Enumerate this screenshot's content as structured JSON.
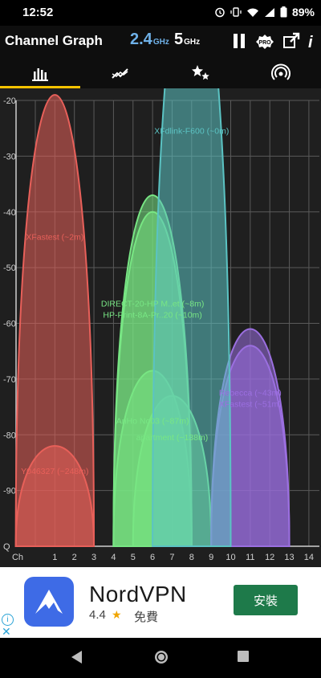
{
  "status": {
    "time": "12:52",
    "battery": "89%"
  },
  "app": {
    "title": "Channel Graph",
    "band24": {
      "num": "2.4",
      "unit": "GHz"
    },
    "band5": {
      "num": "5",
      "unit": "GHz"
    },
    "pro_badge": "PRO",
    "info_label": "i"
  },
  "tabs": [
    {
      "icon": "bar-chart-icon"
    },
    {
      "icon": "time-graph-icon"
    },
    {
      "icon": "stars-rating-icon"
    },
    {
      "icon": "access-point-icon"
    }
  ],
  "colors": {
    "accent": "#f5c300",
    "graph_bg": "#1f1f1f",
    "grid": "#5a5a5a",
    "axis": "#cfcfcf",
    "red": "#e8605a",
    "teal": "#5bc3c3",
    "green": "#78e684",
    "purple": "#9b6fe0"
  },
  "chart_data": {
    "type": "area",
    "ylim": [
      -100,
      -20
    ],
    "y_ticks": [
      "-20",
      "-30",
      "-40",
      "-50",
      "-60",
      "-70",
      "-80",
      "-90",
      "Q"
    ],
    "x_ticks": [
      "Ch",
      "1",
      "2",
      "3",
      "4",
      "5",
      "6",
      "7",
      "8",
      "9",
      "10",
      "11",
      "12",
      "13",
      "14"
    ],
    "networks": [
      {
        "label": "XFastest (~2m)",
        "channel": 1,
        "peak": -46,
        "color": "#e8605a"
      },
      {
        "label": "Y046327 (~248m)",
        "channel": 1,
        "peak": -88,
        "color": "#e8605a"
      },
      {
        "label": "XFdlink-F600 (~0m)",
        "channel": 8,
        "peak": -27,
        "color": "#5bc3c3"
      },
      {
        "label": "DIRECT-20-HP M..et (~8m)",
        "channel": 6,
        "peak": -58,
        "color": "#78e684"
      },
      {
        "label": "HP-Print-8A-Pr..20 (~10m)",
        "channel": 6,
        "peak": -60,
        "color": "#78e684"
      },
      {
        "label": "AnHo No03 (~87m)",
        "channel": 6,
        "peak": -79,
        "color": "#78e684"
      },
      {
        "label": "apartment (~138m)",
        "channel": 7,
        "peak": -82,
        "color": "#78e684"
      },
      {
        "label": "Rebecca (~43m)",
        "channel": 11,
        "peak": -74,
        "color": "#9b6fe0"
      },
      {
        "label": "XFastest (~51m)",
        "channel": 11,
        "peak": -76,
        "color": "#9b6fe0"
      }
    ]
  },
  "ad": {
    "name": "NordVPN",
    "rating": "4.4",
    "price": "免費",
    "install": "安裝",
    "info": "i",
    "close": "✕"
  },
  "nav": [
    {
      "icon": "back-icon"
    },
    {
      "icon": "home-icon"
    },
    {
      "icon": "recents-icon"
    }
  ]
}
